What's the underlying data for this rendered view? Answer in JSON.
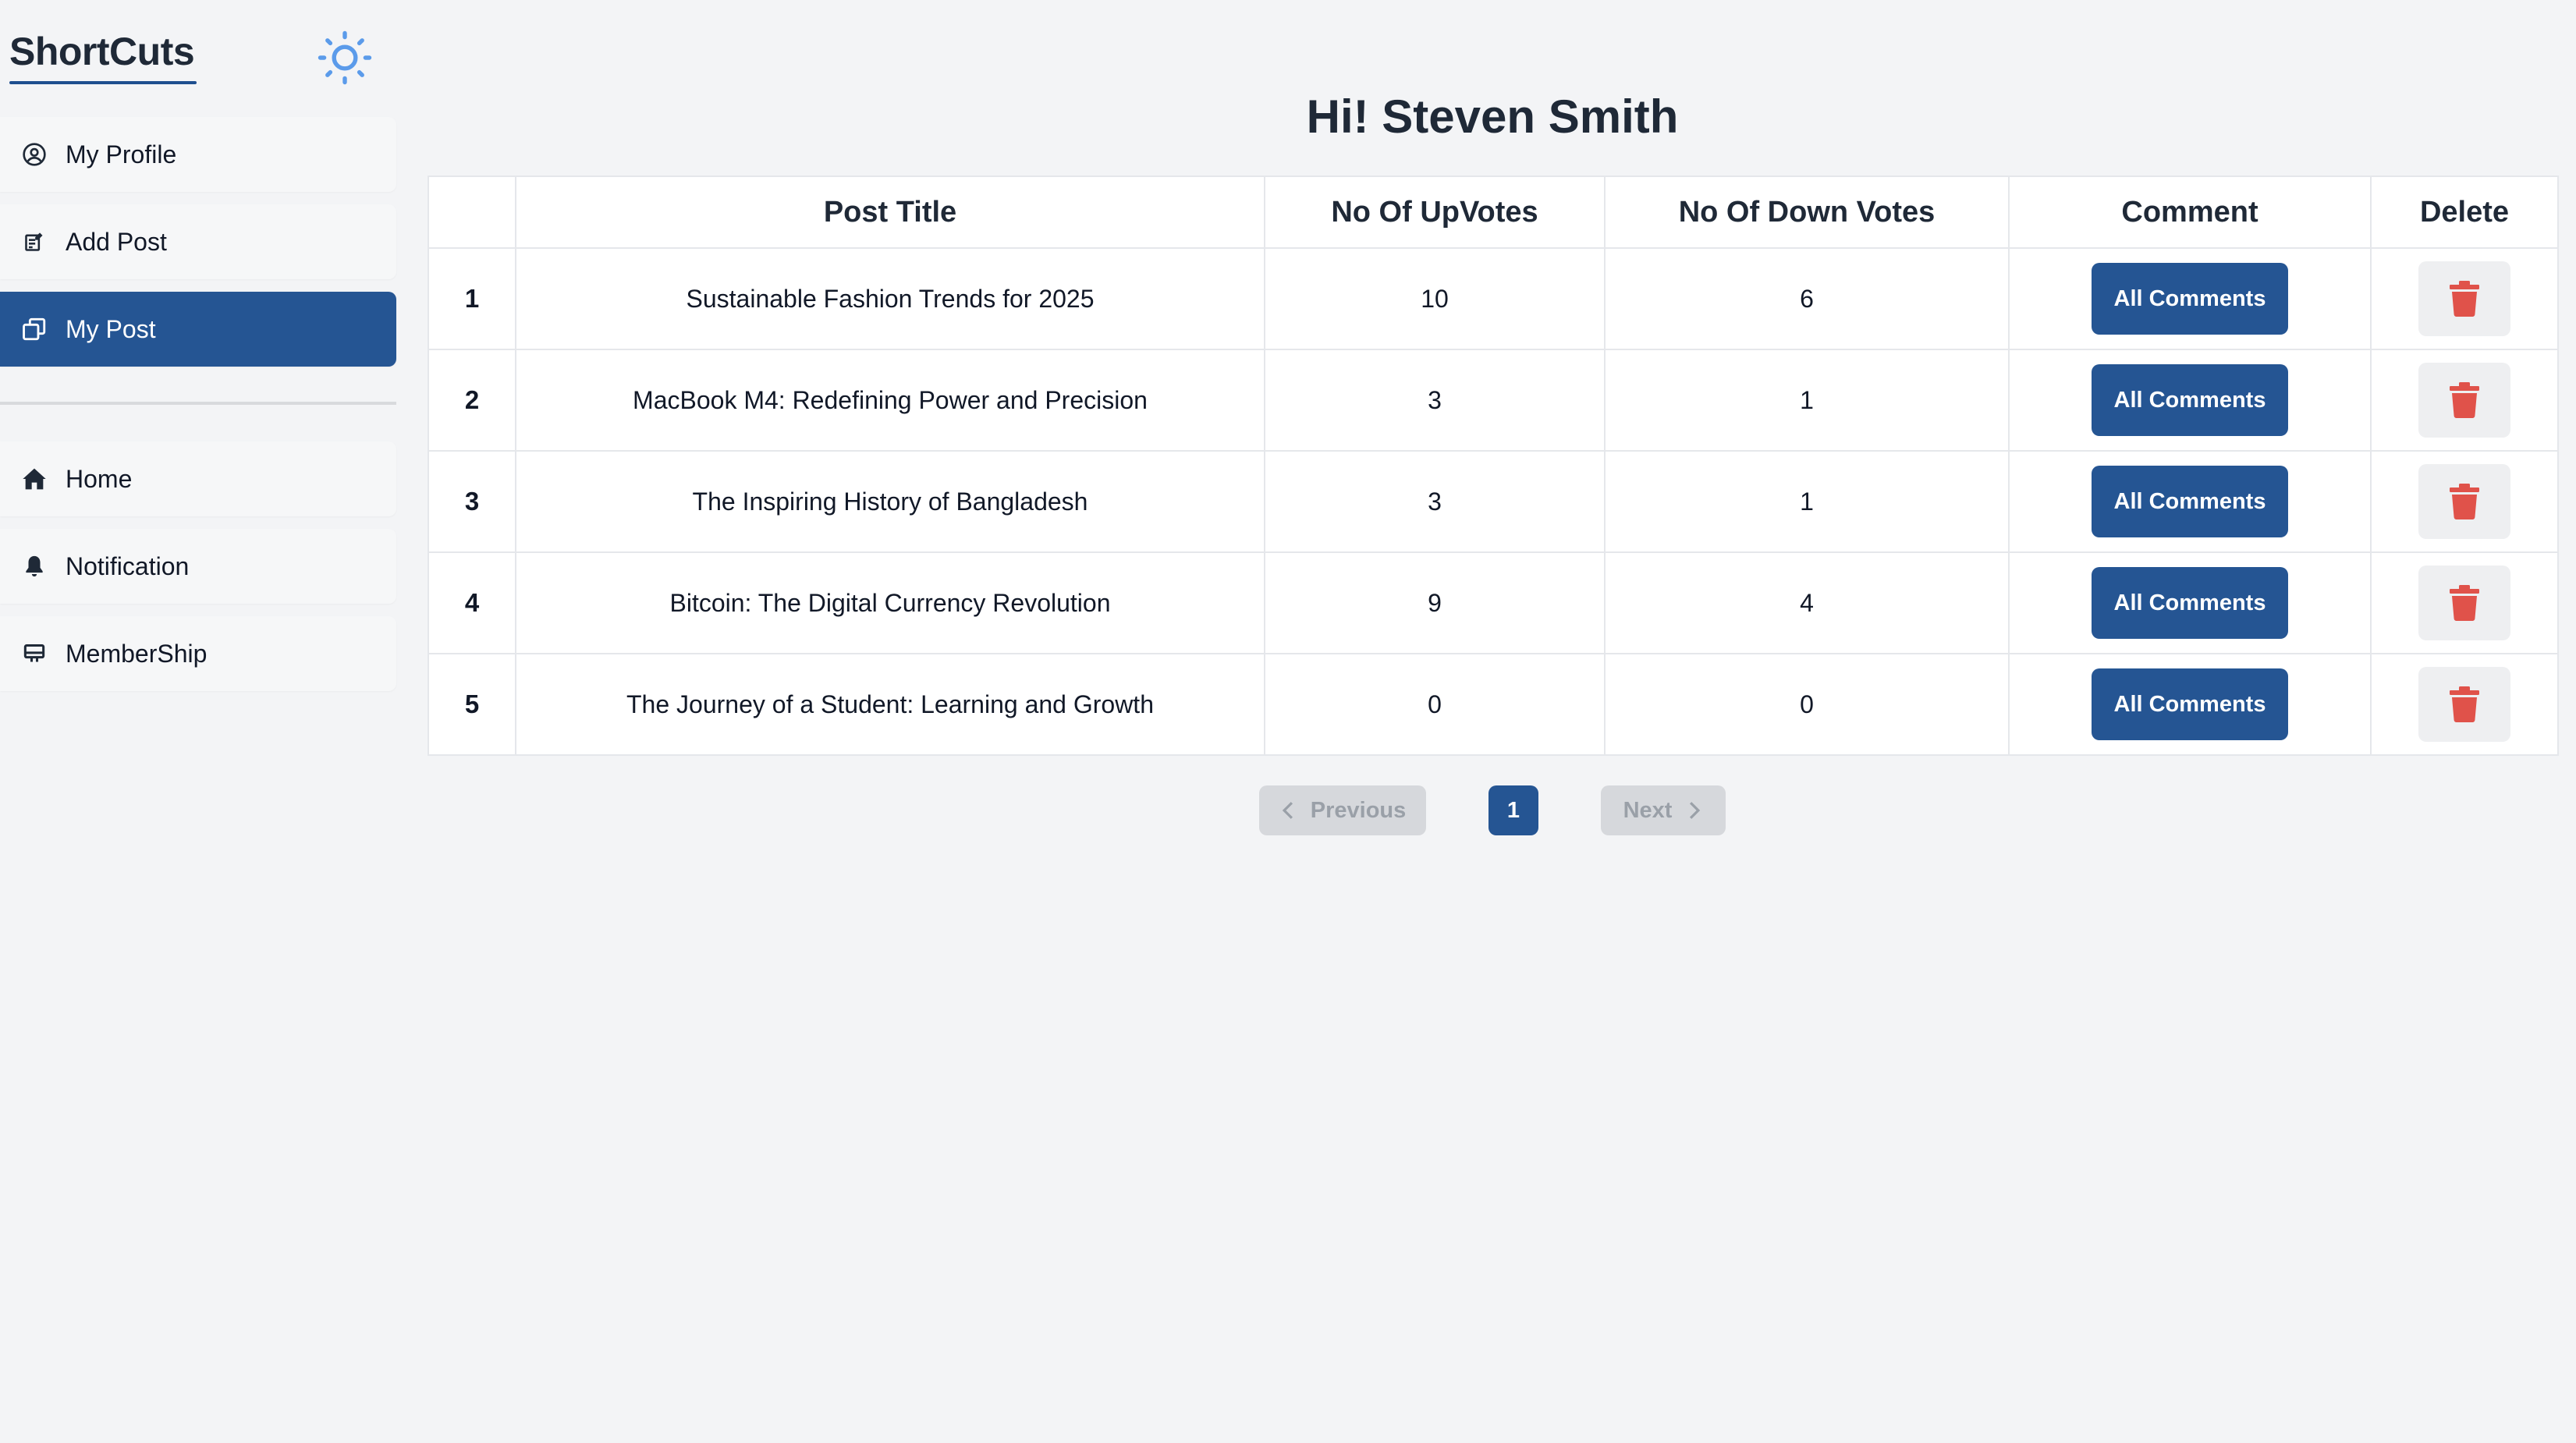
{
  "app": {
    "logo": "ShortCuts",
    "theme_icon": "sun-icon"
  },
  "sidebar": {
    "primary": [
      {
        "label": "My Profile",
        "icon": "user-circle-icon",
        "active": false
      },
      {
        "label": "Add Post",
        "icon": "edit-note-icon",
        "active": false
      },
      {
        "label": "My Post",
        "icon": "copy-icon",
        "active": true
      }
    ],
    "secondary": [
      {
        "label": "Home",
        "icon": "home-icon"
      },
      {
        "label": "Notification",
        "icon": "bell-icon"
      },
      {
        "label": "MemberShip",
        "icon": "monitor-icon"
      }
    ]
  },
  "main": {
    "greeting": "Hi! Steven Smith",
    "table": {
      "headers": [
        "",
        "Post Title",
        "No Of UpVotes",
        "No Of Down Votes",
        "Comment",
        "Delete"
      ],
      "rows": [
        {
          "index": "1",
          "title": "Sustainable Fashion Trends for 2025",
          "upvotes": "10",
          "downvotes": "6",
          "comment_label": "All Comments"
        },
        {
          "index": "2",
          "title": "MacBook M4: Redefining Power and Precision",
          "upvotes": "3",
          "downvotes": "1",
          "comment_label": "All Comments"
        },
        {
          "index": "3",
          "title": "The Inspiring History of Bangladesh",
          "upvotes": "3",
          "downvotes": "1",
          "comment_label": "All Comments"
        },
        {
          "index": "4",
          "title": "Bitcoin: The Digital Currency Revolution",
          "upvotes": "9",
          "downvotes": "4",
          "comment_label": "All Comments"
        },
        {
          "index": "5",
          "title": "The Journey of a Student: Learning and Growth",
          "upvotes": "0",
          "downvotes": "0",
          "comment_label": "All Comments"
        }
      ]
    },
    "pagination": {
      "previous_label": "Previous",
      "current_page": "1",
      "next_label": "Next"
    }
  },
  "colors": {
    "primary": "#255593",
    "delete_icon": "#e0524a",
    "background": "#f3f4f6",
    "sun_icon": "#5b9bea"
  }
}
